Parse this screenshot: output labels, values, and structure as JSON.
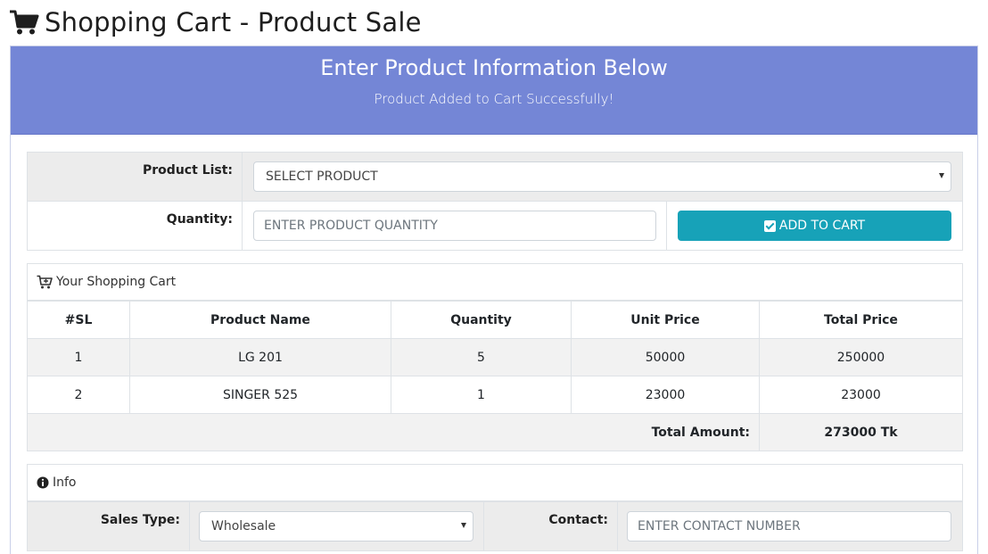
{
  "page": {
    "title": "Shopping Cart - Product Sale",
    "title_icon": "shopping-cart-icon"
  },
  "header": {
    "title": "Enter Product Information Below",
    "message": "Product Added to Cart Successfully!",
    "bg_color": "#7486d6"
  },
  "form": {
    "product_list_label": "Product List:",
    "product_select_value": "SELECT PRODUCT",
    "quantity_label": "Quantity:",
    "quantity_placeholder": "ENTER PRODUCT QUANTITY",
    "add_button_label": "ADD TO CART",
    "add_button_color": "#17a2b8"
  },
  "cart": {
    "heading": "Your Shopping Cart",
    "columns": [
      "#SL",
      "Product Name",
      "Quantity",
      "Unit Price",
      "Total Price"
    ],
    "rows": [
      {
        "sl": "1",
        "product": "LG 201",
        "quantity": "5",
        "unit_price": "50000",
        "total_price": "250000"
      },
      {
        "sl": "2",
        "product": "SINGER 525",
        "quantity": "1",
        "unit_price": "23000",
        "total_price": "23000"
      }
    ],
    "total_label": "Total Amount:",
    "total_value": "273000 Tk"
  },
  "info": {
    "heading": "Info",
    "sales_type_label": "Sales Type:",
    "sales_type_value": "Wholesale",
    "contact_label": "Contact:",
    "contact_placeholder": "ENTER CONTACT NUMBER"
  }
}
